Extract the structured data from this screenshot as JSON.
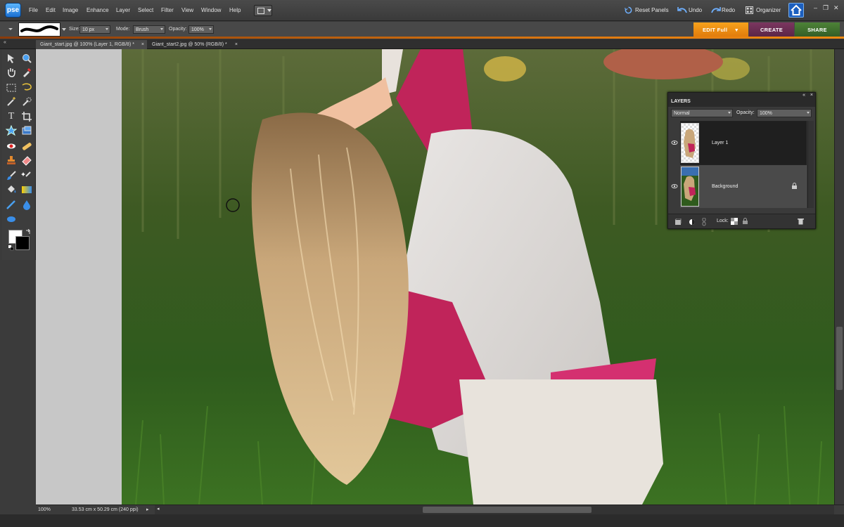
{
  "app": {
    "logo": "pse"
  },
  "menu": [
    "File",
    "Edit",
    "Image",
    "Enhance",
    "Layer",
    "Select",
    "Filter",
    "View",
    "Window",
    "Help"
  ],
  "topbar": {
    "reset_panels": "Reset Panels",
    "undo": "Undo",
    "redo": "Redo",
    "organizer": "Organizer"
  },
  "options": {
    "size_label": "Size:",
    "size_value": "10 px",
    "mode_label": "Mode:",
    "mode_value": "Brush",
    "opacity_label": "Opacity:",
    "opacity_value": "100%"
  },
  "workspace_tabs": {
    "edit": "EDIT Full",
    "create": "CREATE",
    "share": "SHARE"
  },
  "documents": [
    {
      "title": "Giant_start.jpg @ 100% (Layer 1, RGB/8) *",
      "active": true
    },
    {
      "title": "Giant_start2.jpg @ 50% (RGB/8) *",
      "active": false
    }
  ],
  "status": {
    "zoom": "100%",
    "dimensions": "33.53 cm x 50.29 cm (240 ppi)"
  },
  "layers_panel": {
    "title": "LAYERS",
    "blend_mode": "Normal",
    "opacity_label": "Opacity:",
    "opacity_value": "100%",
    "lock_label": "Lock:",
    "layers": [
      {
        "name": "Layer 1",
        "selected": true
      },
      {
        "name": "Background",
        "selected": false,
        "locked": true
      }
    ]
  },
  "colors": {
    "accent_orange": "#e8820e",
    "create_tab": "#6b2d52",
    "share_tab": "#3f6e2e",
    "layer_selected": "#1f1f1f"
  },
  "icons": [
    "move-icon",
    "zoom-icon",
    "hand-icon",
    "eyedropper-icon",
    "marquee-icon",
    "lasso-icon",
    "magic-wand-icon",
    "quick-selection-icon",
    "type-icon",
    "crop-icon",
    "cookie-cutter-icon",
    "recompose-icon",
    "red-eye-icon",
    "healing-brush-icon",
    "clone-stamp-icon",
    "eraser-icon",
    "brush-icon",
    "smart-brush-icon",
    "paint-bucket-icon",
    "gradient-icon",
    "pencil-icon",
    "blur-icon",
    "sponge-icon"
  ]
}
